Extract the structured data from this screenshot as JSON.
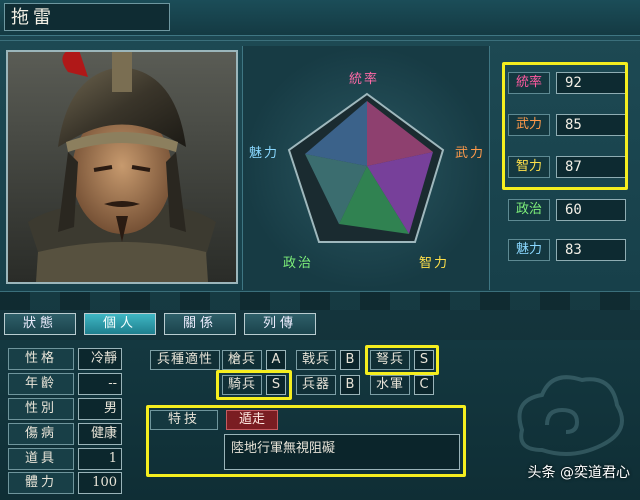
{
  "character": {
    "name": "拖雷"
  },
  "radar": {
    "labels": {
      "leadership": "統率",
      "war": "武力",
      "intelligence": "智力",
      "politics": "政治",
      "charm": "魅力"
    }
  },
  "stats": [
    {
      "label": "統率",
      "value": "92",
      "label_color": "#ff5aa0",
      "highlighted": true
    },
    {
      "label": "武力",
      "value": "85",
      "label_color": "#ff9a4a",
      "highlighted": true
    },
    {
      "label": "智力",
      "value": "87",
      "label_color": "#ffe04a",
      "highlighted": true
    },
    {
      "label": "政治",
      "value": "60",
      "label_color": "#7ef07a",
      "highlighted": false
    },
    {
      "label": "魅力",
      "value": "83",
      "label_color": "#8ad8ff",
      "highlighted": false
    }
  ],
  "tabs": [
    {
      "label": "狀態",
      "active": false
    },
    {
      "label": "個人",
      "active": true
    },
    {
      "label": "關係",
      "active": false
    },
    {
      "label": "列傳",
      "active": false
    }
  ],
  "personal": [
    {
      "label": "性格",
      "value": "冷靜"
    },
    {
      "label": "年齡",
      "value": "--"
    },
    {
      "label": "性別",
      "value": "男"
    },
    {
      "label": "傷病",
      "value": "健康"
    },
    {
      "label": "道具",
      "value": "1"
    },
    {
      "label": "體力",
      "value": "100"
    }
  ],
  "aptitude": {
    "header": "兵種適性",
    "units": [
      {
        "label": "槍兵",
        "grade": "A"
      },
      {
        "label": "戟兵",
        "grade": "B"
      },
      {
        "label": "弩兵",
        "grade": "S"
      },
      {
        "label": "騎兵",
        "grade": "S"
      },
      {
        "label": "兵器",
        "grade": "B"
      },
      {
        "label": "水軍",
        "grade": "C"
      }
    ]
  },
  "skill": {
    "label": "特技",
    "name": "遁走",
    "description": "陸地行軍無視阻礙"
  },
  "watermark": {
    "text": "头条 @奕道君心"
  },
  "colors": {
    "highlight": "#f5ee1f",
    "active_tab": "#3fb7c4",
    "skill_red": "#7a1d22"
  }
}
